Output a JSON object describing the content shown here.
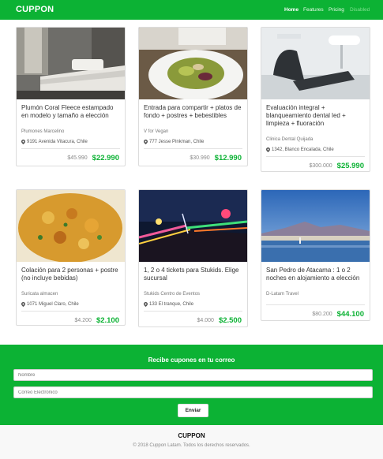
{
  "brand": "CUPPON",
  "nav": {
    "home": "Home",
    "features": "Features",
    "pricing": "Pricing",
    "disabled": "Disabled"
  },
  "cards": [
    {
      "title": "Plumón Coral Fleece estampado en modelo y tamaño a elección",
      "vendor": "Plumones Marcelino",
      "address": "9191 Avenida Vitacura, Chile",
      "old_price": "$45.990",
      "new_price": "$22.990",
      "image": "bed-photo"
    },
    {
      "title": "Entrada para compartir + platos de fondo + postres + bebestibles",
      "vendor": "V for Vegan",
      "address": "777 Jesse Pinkman, Chile",
      "old_price": "$30.990",
      "new_price": "$12.990",
      "image": "salad-photo"
    },
    {
      "title": "Evaluación integral + blanqueamiento dental led + limpieza + fluoración",
      "vendor": "Clinica Dental Quijada",
      "address": "1342, Blanco Encalada, Chile",
      "old_price": "$300.000",
      "new_price": "$25.990",
      "image": "dental-chair-photo"
    },
    {
      "title": "Colación para 2 personas + postre (no incluye bebidas)",
      "vendor": "Suricata almacen",
      "address": "1071 Miguel Claro, Chile",
      "old_price": "$4.200",
      "new_price": "$2.100",
      "image": "food-bowl-photo"
    },
    {
      "title": "1, 2 o 4 tickets para Stukids. Elige sucursal",
      "vendor": "Stukids Centro de Eventos",
      "address": "133 El tranque, Chile",
      "old_price": "$4.000",
      "new_price": "$2.500",
      "image": "carnival-lights-photo"
    },
    {
      "title": "San Pedro de Atacama : 1 o 2 noches en alojamiento a elección",
      "vendor": "D-Latam Travel",
      "address": "",
      "old_price": "$80.200",
      "new_price": "$44.100",
      "image": "lake-landscape-photo"
    }
  ],
  "newsletter": {
    "title": "Recibe cupones en tu correo",
    "name_placeholder": "Nombre",
    "email_placeholder": "Correo Electrónico",
    "submit_label": "Enviar"
  },
  "footer": {
    "brand": "CUPPON",
    "copyright": "© 2018 Cuppon Latam. Todos los derechos reservados."
  },
  "colors": {
    "primary_green": "#0cb234"
  }
}
